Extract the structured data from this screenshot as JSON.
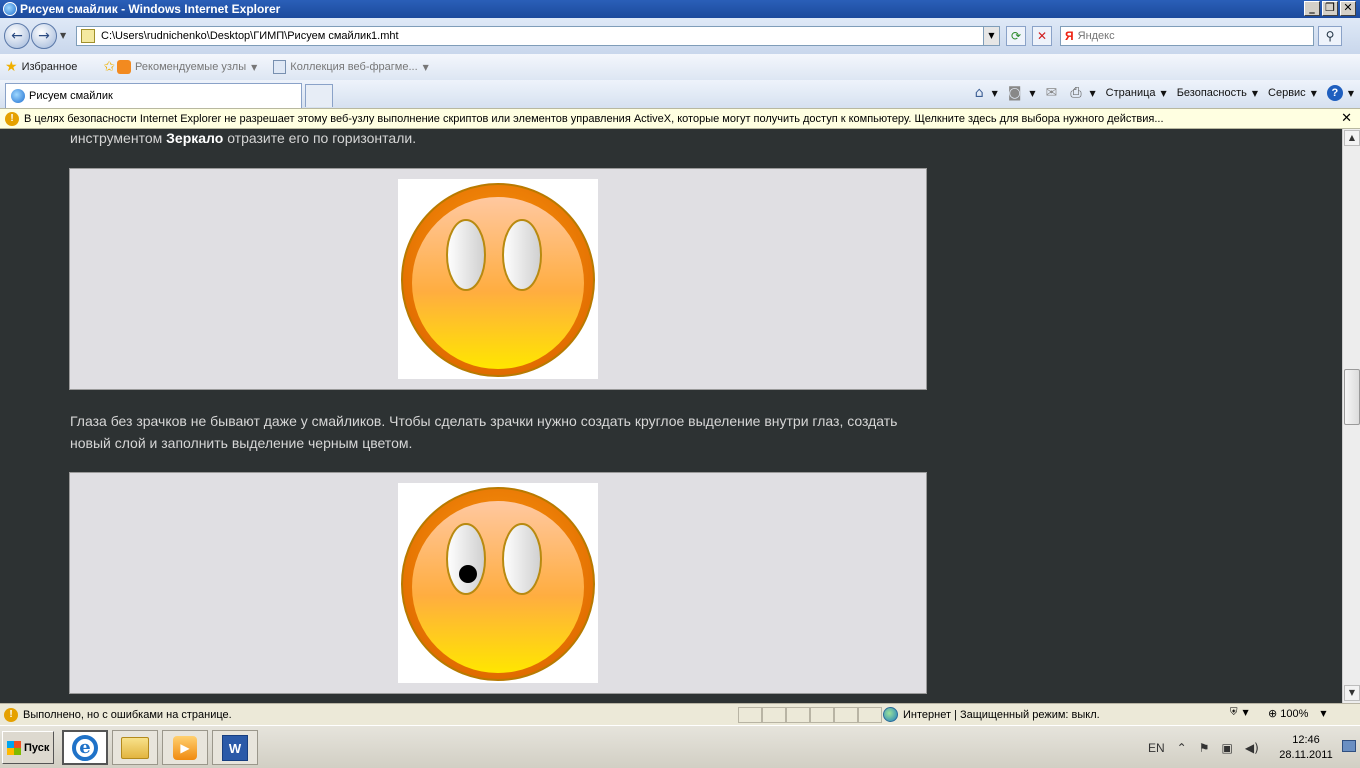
{
  "window": {
    "title": "Рисуем смайлик - Windows Internet Explorer",
    "min_label": "_",
    "restore_label": "❐",
    "close_label": "✕"
  },
  "address": {
    "back_label": "←",
    "forward_label": "→",
    "url": "C:\\Users\\rudnichenko\\Desktop\\ГИМП\\Рисуем смайлик1.mht",
    "search_placeholder": "Яндекс",
    "search_brand": "Я"
  },
  "favorites": {
    "favorites_label": "Избранное",
    "suggested_label": "Рекомендуемые узлы",
    "gallery_label": "Коллекция веб-фрагме..."
  },
  "tabs": [
    {
      "label": "Рисуем смайлик"
    }
  ],
  "commands": {
    "page_label": "Страница",
    "safety_label": "Безопасность",
    "tools_label": "Сервис",
    "help_label": "?"
  },
  "infobar": {
    "text": "В целях безопасности Internet Explorer не разрешает этому веб-узлу выполнение скриптов или элементов управления ActiveX, которые могут получить доступ к компьютеру. Щелкните здесь для выбора нужного действия...",
    "close_label": "✕"
  },
  "article": {
    "para1_start": "инструментом ",
    "para1_bold": "Зеркало",
    "para1_end": " отразите его по горизонтали.",
    "para2": "Глаза без зрачков не бывают даже у смайликов. Чтобы сделать зрачки нужно создать круглое выделение внутри глаз, создать новый слой и заполнить выделение черным цветом.",
    "image1": {
      "pupil": false
    },
    "image2": {
      "pupil": true
    }
  },
  "status": {
    "text": "Выполнено, но с ошибками на странице.",
    "zone": "Интернет | Защищенный режим: выкл.",
    "zoom": "100%"
  },
  "taskbar": {
    "start_label": "Пуск",
    "word_label": "W",
    "ie_label": "e",
    "lang": "EN",
    "time": "12:46",
    "date": "28.11.2011"
  },
  "colors": {
    "content_bg": "#2d3233",
    "smiley_rim": "#f08a00",
    "smiley_face": "#ffb340",
    "smiley_chin": "#ffe000"
  }
}
